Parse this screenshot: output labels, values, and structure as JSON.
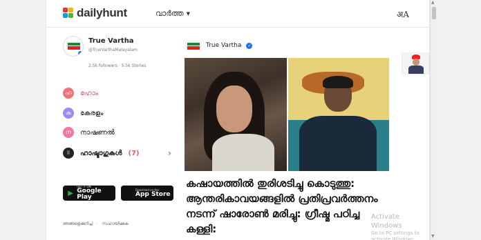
{
  "header": {
    "logo_text": "dailyhunt",
    "logo_colors": [
      "#e5333a",
      "#f7b500",
      "#1a9bd7",
      "#4caf50"
    ],
    "lang_menu_label": "വാർത്ത",
    "transliterate_label": "अA"
  },
  "profile": {
    "name": "True Vartha",
    "handle": "@TrueVarthaMalayalam",
    "followers": "2.5k followers",
    "separator": "·",
    "stories": "5.5k Stories"
  },
  "nav": {
    "items": [
      {
        "icon_letter": "ഹ",
        "label": "ഹോം",
        "color": "#f0717a",
        "active": true
      },
      {
        "icon_letter": "ക",
        "label": "കേരളം",
        "color": "#9b8cf0"
      },
      {
        "icon_letter": "ന",
        "label": "നാഷണൽ",
        "color": "#f07a9e"
      },
      {
        "icon_letter": "",
        "label": "ഹാഷ്ടാഗുകൾ",
        "count": "(7)",
        "color": "#222"
      }
    ]
  },
  "stores": {
    "google": {
      "small": "GET IT ON",
      "big": "Google Play"
    },
    "apple": {
      "small": "Download on the",
      "big": "App Store"
    }
  },
  "footer": {
    "about": "ഞങ്ങളെക്കുറിച്ച്",
    "help": "സഹായിക്കുക"
  },
  "article": {
    "source": "True Vartha",
    "title": "കഷായത്തിൽ തുരിശടിച്ചു കൊടുത്തു: ആന്തരികാവയങ്ങളിൽ പ്രതിപ്രവർത്തനം നടന്ന് ഷാരോൺ മരിച്ചു: ഗ്രീഷ്മ പഠിച്ച കള്ളി:"
  },
  "watermark": {
    "line1": "Activate Windows",
    "line2": "Go to PC settings to activate Windows."
  }
}
